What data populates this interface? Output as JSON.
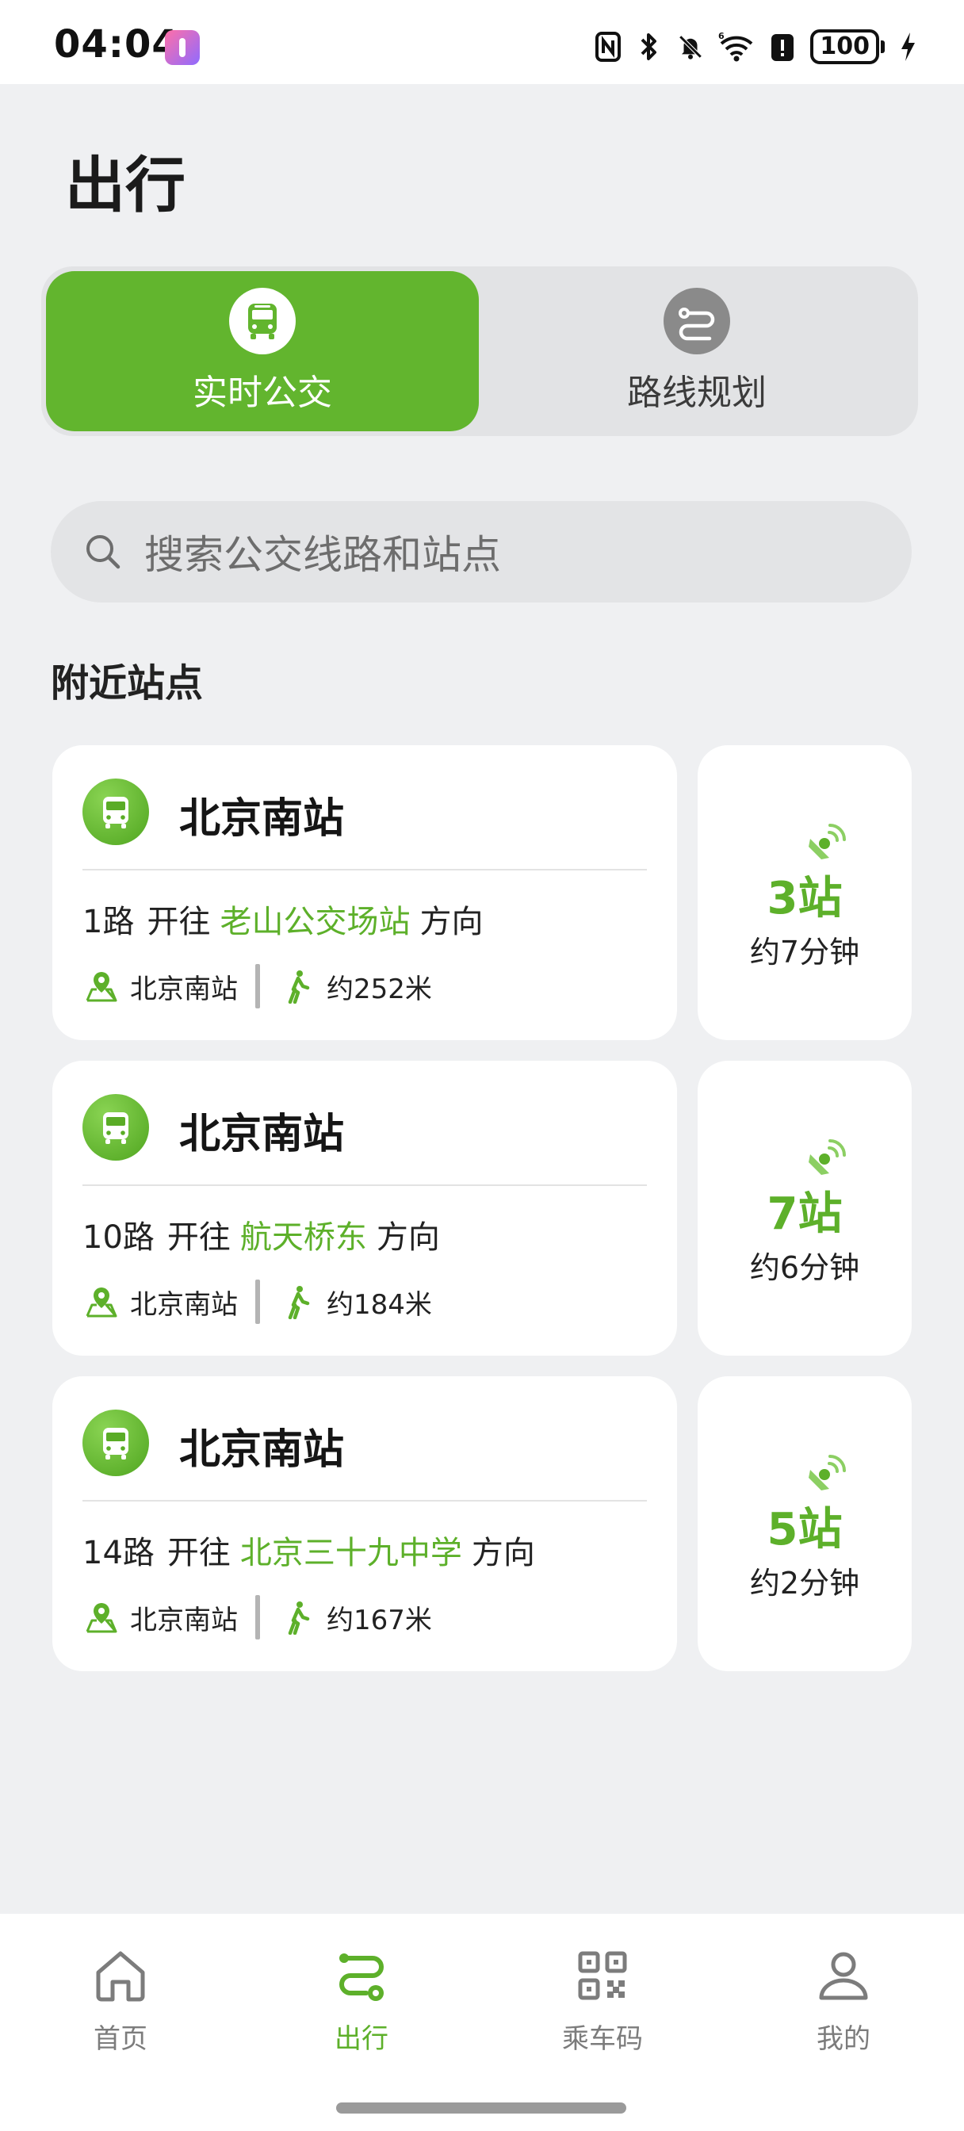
{
  "status_bar": {
    "time": "04:04",
    "battery": "100",
    "icons": [
      "nfc-icon",
      "bluetooth-icon",
      "mute-icon",
      "wifi-6-icon",
      "alert-icon",
      "battery-icon",
      "charging-icon"
    ]
  },
  "page": {
    "title": "出行"
  },
  "segment": {
    "active_label": "实时公交",
    "inactive_label": "路线规划"
  },
  "search": {
    "placeholder": "搜索公交线路和站点"
  },
  "nearby": {
    "title": "附近站点",
    "stations": [
      {
        "name": "北京南站",
        "route": "1路",
        "toward": "开往",
        "destination": "老山公交场站",
        "direction": "方向",
        "stop": "北京南站",
        "distance": "约252米",
        "stops": "3站",
        "eta": "约7分钟"
      },
      {
        "name": "北京南站",
        "route": "10路",
        "toward": "开往",
        "destination": "航天桥东",
        "direction": "方向",
        "stop": "北京南站",
        "distance": "约184米",
        "stops": "7站",
        "eta": "约6分钟"
      },
      {
        "name": "北京南站",
        "route": "14路",
        "toward": "开往",
        "destination": "北京三十九中学",
        "direction": "方向",
        "stop": "北京南站",
        "distance": "约167米",
        "stops": "5站",
        "eta": "约2分钟"
      }
    ]
  },
  "bottom_nav": {
    "items": [
      {
        "label": "首页",
        "icon": "home-icon"
      },
      {
        "label": "出行",
        "icon": "route-icon"
      },
      {
        "label": "乘车码",
        "icon": "qr-code-icon"
      },
      {
        "label": "我的",
        "icon": "profile-icon"
      }
    ],
    "active_index": 1
  },
  "colors": {
    "accent": "#62b52e",
    "background": "#eff0f2",
    "card": "#ffffff"
  }
}
